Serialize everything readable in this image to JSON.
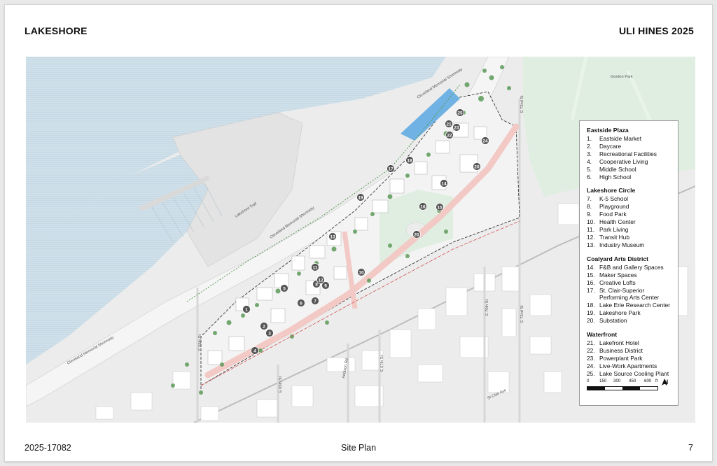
{
  "header": {
    "left_title": "LAKESHORE",
    "right_title": "ULI HINES 2025"
  },
  "footer": {
    "left": "2025-17082",
    "center": "Site Plan",
    "right": "7"
  },
  "map": {
    "colors": {
      "water": "#cfe0ea",
      "land": "#ececec",
      "park": "#dfeee0",
      "tree": "#5c9a58",
      "site_path": "#f2c9c4",
      "buildings": "#ffffff"
    },
    "road_labels": {
      "shoreway_1": "Cleveland Memorial Shoreway",
      "shoreway_2": "Cleveland Memorial Shoreway",
      "shoreway_3": "Cleveland Memorial Shoreway",
      "lakefront_trail": "Lakefront Trail",
      "gordon_park": "Gordon Park",
      "e72_top": "E 72nd St",
      "e72_mid": "E 72nd St",
      "e70": "E 70th St",
      "e67": "E 67th St",
      "e65": "E 65th St",
      "e55": "E 55th St",
      "addison": "Addison Rd",
      "clair": "St Clair Ave"
    },
    "markers": [
      {
        "n": "1"
      },
      {
        "n": "2"
      },
      {
        "n": "3"
      },
      {
        "n": "4"
      },
      {
        "n": "5"
      },
      {
        "n": "6"
      },
      {
        "n": "7"
      },
      {
        "n": "8"
      },
      {
        "n": "9"
      },
      {
        "n": "10"
      },
      {
        "n": "11"
      },
      {
        "n": "12"
      },
      {
        "n": "13"
      },
      {
        "n": "14"
      },
      {
        "n": "15"
      },
      {
        "n": "16"
      },
      {
        "n": "17"
      },
      {
        "n": "18"
      },
      {
        "n": "19"
      },
      {
        "n": "20"
      },
      {
        "n": "20"
      },
      {
        "n": "21"
      },
      {
        "n": "22"
      },
      {
        "n": "23"
      },
      {
        "n": "24"
      },
      {
        "n": "25"
      }
    ]
  },
  "legend": {
    "groups": [
      {
        "title": "Eastside Plaza",
        "items": [
          {
            "n": "1.",
            "label": "Eastside Market"
          },
          {
            "n": "2.",
            "label": "Daycare"
          },
          {
            "n": "3.",
            "label": "Recreational Facilities"
          },
          {
            "n": "4.",
            "label": "Cooperative Living"
          },
          {
            "n": "5.",
            "label": "Middle School"
          },
          {
            "n": "6.",
            "label": "High School"
          }
        ]
      },
      {
        "title": "Lakeshore Circle",
        "items": [
          {
            "n": "7.",
            "label": "K-5 School"
          },
          {
            "n": "8.",
            "label": "Playground"
          },
          {
            "n": "9.",
            "label": "Food Park"
          },
          {
            "n": "10.",
            "label": "Health Center"
          },
          {
            "n": "11.",
            "label": "Park Living"
          },
          {
            "n": "12.",
            "label": "Transit Hub"
          },
          {
            "n": "13.",
            "label": "Industry Museum"
          }
        ]
      },
      {
        "title": "Coalyard Arts District",
        "items": [
          {
            "n": "14.",
            "label": "F&B and Gallery Spaces"
          },
          {
            "n": "15.",
            "label": "Maker Spaces"
          },
          {
            "n": "16.",
            "label": "Creative Lofts"
          },
          {
            "n": "17.",
            "label": "St. Clair-Superior Performing Arts Center"
          },
          {
            "n": "18.",
            "label": "Lake Erie Research Center"
          },
          {
            "n": "19.",
            "label": "Lakeshore Park"
          },
          {
            "n": "20.",
            "label": "Substation"
          }
        ]
      },
      {
        "title": "Waterfront",
        "items": [
          {
            "n": "21.",
            "label": "Lakefront Hotel"
          },
          {
            "n": "22.",
            "label": "Business District"
          },
          {
            "n": "23.",
            "label": "Powerplant Park"
          },
          {
            "n": "24.",
            "label": "Live-Work Apartments"
          },
          {
            "n": "25.",
            "label": "Lake Source Cooling Plant"
          }
        ]
      }
    ],
    "scale": {
      "ticks": [
        "0",
        "150",
        "300",
        "450",
        "600",
        "ft"
      ],
      "north": "N"
    }
  }
}
